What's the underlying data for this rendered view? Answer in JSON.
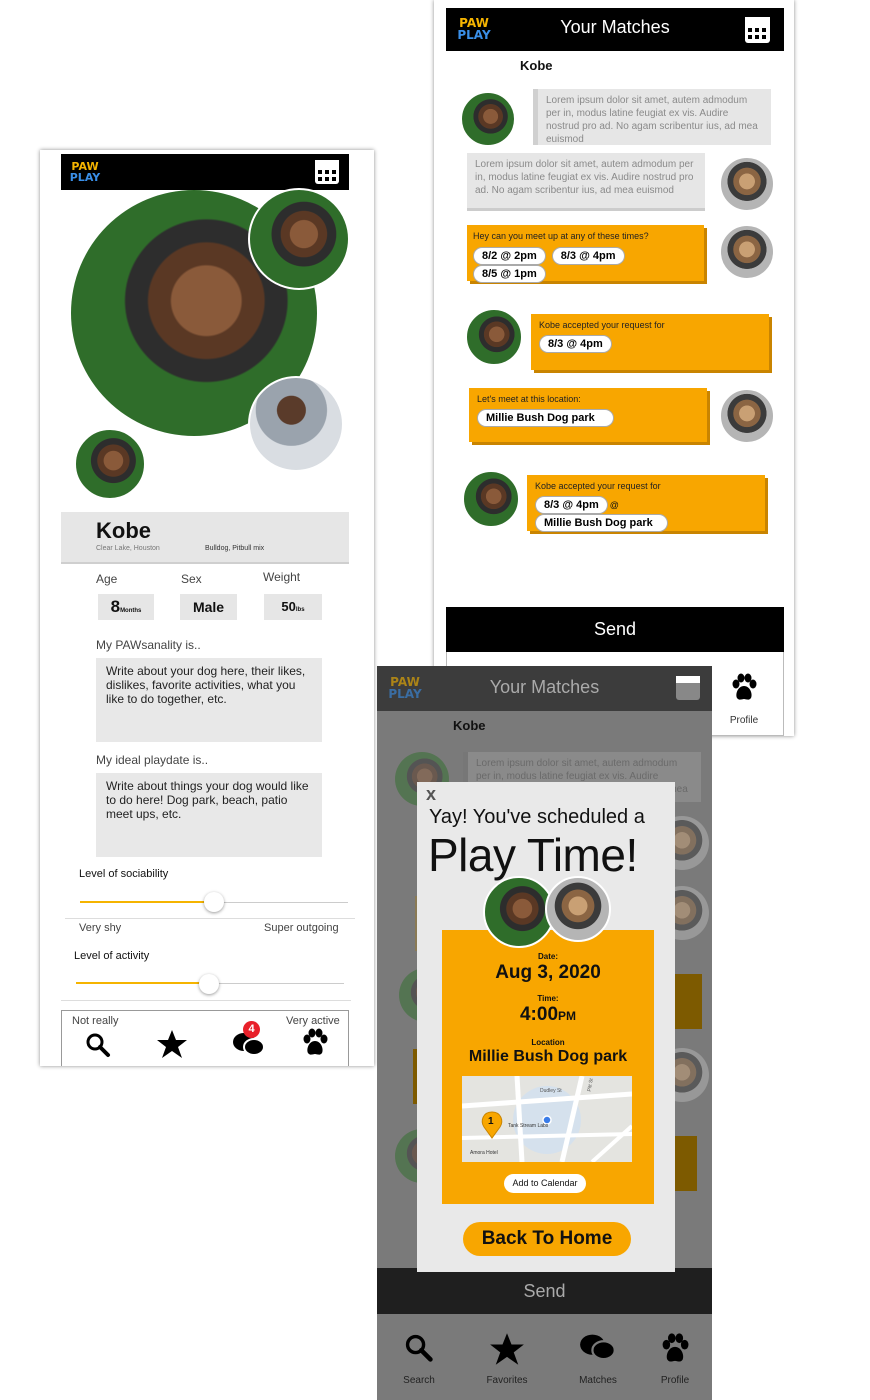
{
  "app": {
    "logo_line1": "PAW",
    "logo_line2": "PLAY"
  },
  "profile": {
    "name": "Kobe",
    "location": "Clear Lake, Houston",
    "breed": "Bulldog, Pitbull mix",
    "age_label": "Age",
    "sex_label": "Sex",
    "weight_label": "Weight",
    "age_value": "8",
    "age_unit": "Months",
    "sex_value": "Male",
    "weight_value": "50",
    "weight_unit": "lbs",
    "pawsanality_label": "My PAWsanality is..",
    "pawsanality_text": "Write about your dog here, their likes, dislikes, favorite activities, what you like to do together, etc.",
    "playdate_label": "My ideal playdate is..",
    "playdate_text": "Write about things your dog would like to do here! Dog park, beach, patio meet ups, etc.",
    "sociability_label": "Level of sociability",
    "sociability_min": "Very shy",
    "sociability_max": "Super outgoing",
    "sociability_level": 0.5,
    "activity_label": "Level of activity",
    "activity_min": "Not really",
    "activity_max": "Very active",
    "activity_level": 0.5,
    "notification_count": "4"
  },
  "matches": {
    "title": "Your Matches",
    "partner_name": "Kobe",
    "lorem": "Lorem ipsum dolor sit amet, autem admodum per in, modus latine feugiat ex vis. Audire nostrud pro ad. No agam scribentur ius, ad mea euismod",
    "meet_request": "Hey can you meet up at any of these times?",
    "times": [
      "8/2 @ 2pm",
      "8/3 @ 4pm",
      "8/5 @ 1pm"
    ],
    "accepted_time_text": "Kobe accepted your request for",
    "accepted_time": "8/3 @ 4pm",
    "location_prompt": "Let's meet at this location:",
    "location": "Millie Bush Dog park",
    "accepted_both_text": "Kobe accepted your request for",
    "at_symbol": "@",
    "send_label": "Send",
    "nav_profile": "Profile"
  },
  "modal": {
    "close": "x",
    "headline": "Yay! You've scheduled a",
    "big_title": "Play Time!",
    "date_label": "Date:",
    "date_value": "Aug 3, 2020",
    "time_label": "Time:",
    "time_value": "4:00",
    "time_suffix": "PM",
    "location_label": "Location",
    "location_value": "Millie Bush Dog park",
    "add_calendar": "Add to Calendar",
    "back_home": "Back To Home",
    "map_pin_number": "1",
    "map_street1": "Dudley St",
    "map_street2": "Pitt St",
    "map_poi": "Tank Stream Labs",
    "map_hotel": "Amora Hotel"
  },
  "bottom_nav": {
    "search": "Search",
    "favorites": "Favorites",
    "matches": "Matches",
    "profile": "Profile"
  },
  "colors": {
    "accent": "#f8a600",
    "topbar": "#000000",
    "field_grey": "#e8e8e8",
    "badge": "#e8202a"
  }
}
